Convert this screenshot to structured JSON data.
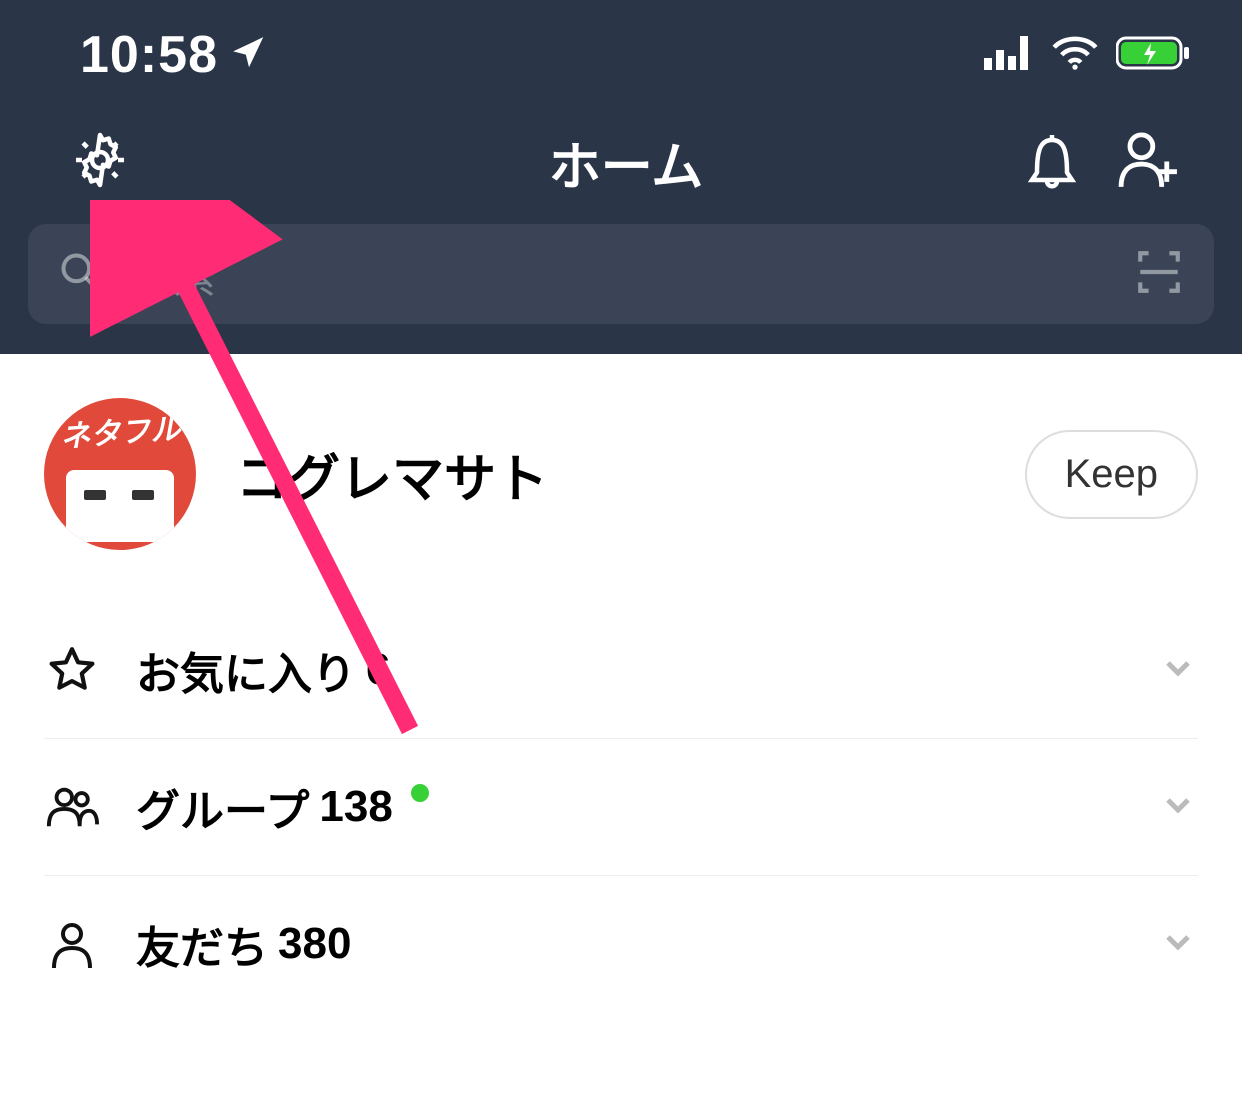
{
  "status": {
    "time": "10:58"
  },
  "nav": {
    "title": "ホーム"
  },
  "search": {
    "placeholder": "検索"
  },
  "profile": {
    "avatar_text": "ネタフル",
    "name": "コグレマサト",
    "keep_label": "Keep"
  },
  "sections": {
    "favorites": {
      "label": "お気に入り",
      "count": "6"
    },
    "groups": {
      "label": "グループ",
      "count": "138",
      "has_badge": true
    },
    "friends": {
      "label": "友だち",
      "count": "380"
    }
  }
}
